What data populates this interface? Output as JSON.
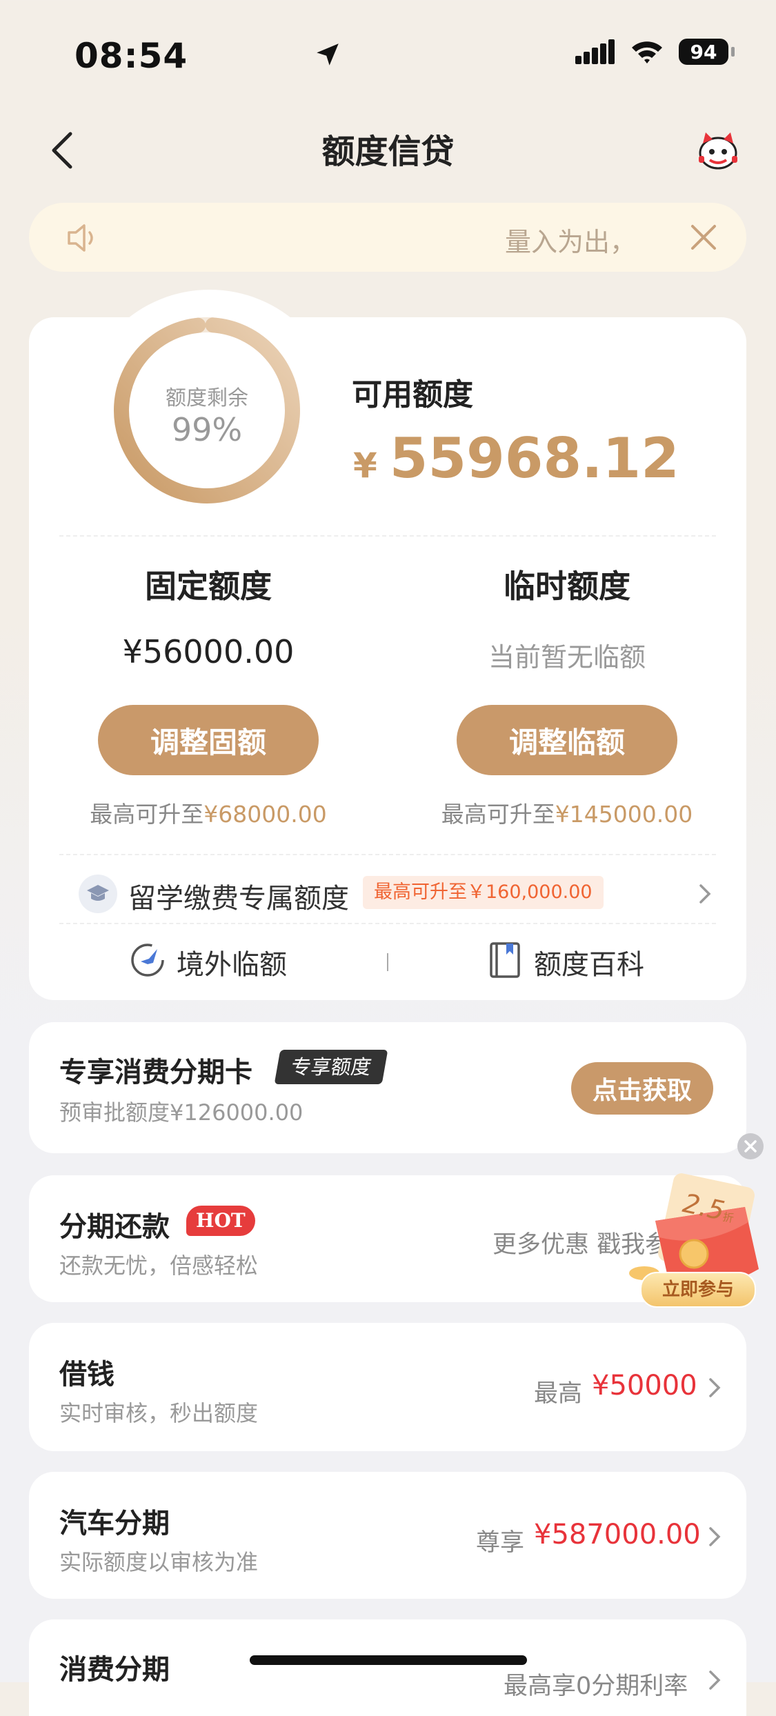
{
  "status_bar": {
    "time": "08:54",
    "battery": "94"
  },
  "nav": {
    "title": "额度信贷"
  },
  "notice": {
    "text": "量入为出，"
  },
  "credit": {
    "ring_label": "额度剩余",
    "ring_percent": "99%",
    "ring_fraction": 0.99,
    "available_label": "可用额度",
    "currency": "¥",
    "available_amount": "55968.12"
  },
  "fixed": {
    "title": "固定额度",
    "value": "¥56000.00",
    "button": "调整固额",
    "note_prefix": "最高可升至",
    "note_amount": "¥68000.00"
  },
  "temporary": {
    "title": "临时额度",
    "value": "当前暂无临额",
    "button": "调整临额",
    "note_prefix": "最高可升至",
    "note_amount": "¥145000.00"
  },
  "study": {
    "label": "留学缴费专属额度",
    "tag": "最高可升至￥160,000.00"
  },
  "links": {
    "overseas": "境外临额",
    "wiki": "额度百科"
  },
  "consumer_card": {
    "title": "专享消费分期卡",
    "badge": "专享额度",
    "subtitle": "预审批额度¥126000.00",
    "button": "点击获取"
  },
  "installment": {
    "title": "分期还款",
    "badge": "HOT",
    "subtitle": "还款无忧，倍感轻松",
    "right_text": "更多优惠 戳我参"
  },
  "floating_promo": {
    "number": "2.5",
    "unit": "折",
    "button": "立即参与"
  },
  "borrow": {
    "title": "借钱",
    "subtitle": "实时审核，秒出额度",
    "prefix": "最高",
    "amount": "¥50000"
  },
  "car_loan": {
    "title": "汽车分期",
    "subtitle": "实际额度以审核为准",
    "prefix": "尊享",
    "amount": "¥587000.00"
  },
  "consumer_loan": {
    "title": "消费分期",
    "right_text": "最高享0分期利率"
  },
  "colors": {
    "gold": "#c9996a",
    "red": "#e8333a",
    "notice_bg": "#fdf6e6"
  }
}
